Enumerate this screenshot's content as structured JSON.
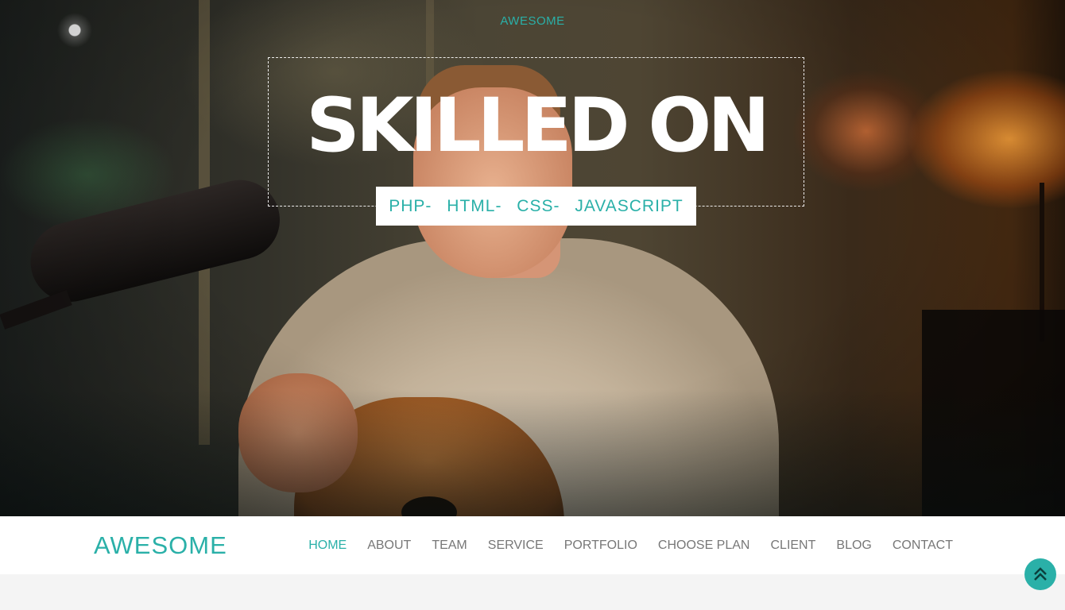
{
  "hero": {
    "subtitle": "AWESOME",
    "title": "SKILLED ON",
    "skills": [
      "PHP-",
      "HTML-",
      "CSS-",
      "JAVASCRIPT"
    ]
  },
  "navbar": {
    "brand": "AWESOME",
    "items": [
      {
        "label": "HOME",
        "active": true
      },
      {
        "label": "ABOUT"
      },
      {
        "label": "TEAM"
      },
      {
        "label": "SERVICE"
      },
      {
        "label": "PORTFOLIO"
      },
      {
        "label": "CHOOSE PLAN"
      },
      {
        "label": "CLIENT"
      },
      {
        "label": "BLOG"
      },
      {
        "label": "CONTACT"
      }
    ]
  },
  "scroll_top": {
    "icon": "double-chevron-up-icon"
  },
  "colors": {
    "accent": "#2ab0a8",
    "nav_text": "#777777",
    "page_bg": "#f4f4f4"
  }
}
